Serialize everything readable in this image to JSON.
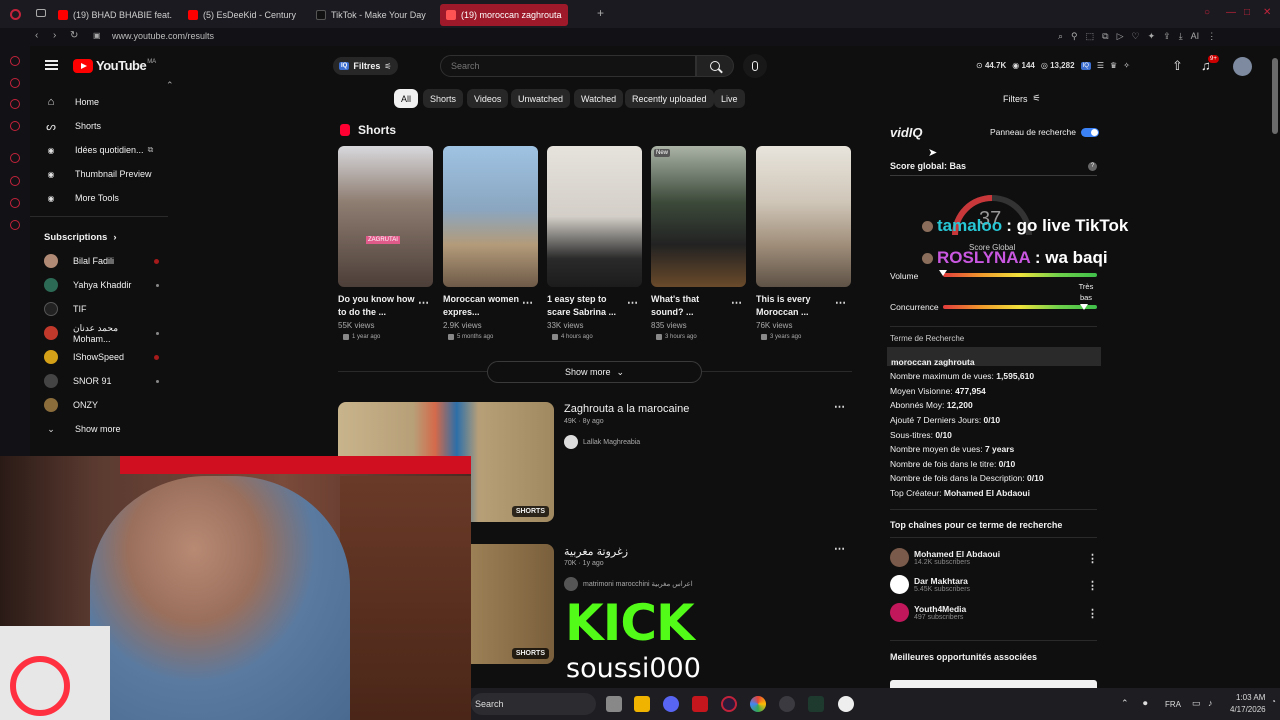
{
  "browser": {
    "tabs": [
      {
        "label": "(19) BHAD BHABIE feat. Li",
        "active": false
      },
      {
        "label": "(5) EsDeeKid - Century -",
        "active": false
      },
      {
        "label": "TikTok - Make Your Day",
        "active": false
      },
      {
        "label": "(19) moroccan zaghrouta",
        "active": true
      }
    ],
    "url": "www.youtube.com/results"
  },
  "header": {
    "logo": "YouTube",
    "country": "MA",
    "filters_label": "Filtres",
    "search_placeholder": "Search",
    "stats": [
      "44.7K",
      "144",
      "13,282"
    ],
    "notif_badge": "9+"
  },
  "sidebar": {
    "items": [
      {
        "label": "Home",
        "icon": "home-icon"
      },
      {
        "label": "Shorts",
        "icon": "shorts-icon"
      },
      {
        "label": "Idées quotidien...",
        "icon": "idea-icon"
      },
      {
        "label": "Thumbnail Preview",
        "icon": "preview-icon"
      },
      {
        "label": "More Tools",
        "icon": "tools-icon"
      }
    ],
    "subscriptions_title": "Subscriptions",
    "subscriptions": [
      {
        "name": "Bilal Fadili",
        "color": "#b08a74",
        "live": "#a51a1a"
      },
      {
        "name": "Yahya Khaddir",
        "color": "#2c6a55",
        "live": "#888888"
      },
      {
        "name": "TIF",
        "color": "#222222",
        "live": ""
      },
      {
        "name": "محمد عدنان Moham...",
        "color": "#c0392b",
        "live": "#888888"
      },
      {
        "name": "IShowSpeed",
        "color": "#d4a017",
        "live": "#a51a1a"
      },
      {
        "name": "SNOR 91",
        "color": "#444444",
        "live": "#888888"
      },
      {
        "name": "ONZY",
        "color": "#8a6d3b",
        "live": ""
      }
    ],
    "show_more": "Show more"
  },
  "chips": [
    "All",
    "Shorts",
    "Videos",
    "Unwatched",
    "Watched",
    "Recently uploaded",
    "Live"
  ],
  "filters_right": "Filters",
  "shorts": {
    "section_title": "Shorts",
    "items": [
      {
        "title": "Do you know how to do the ...",
        "views": "55K views",
        "ago": "1 year ago",
        "thumb": "#8a7a6f"
      },
      {
        "title": "Moroccan women expres...",
        "views": "2.9K views",
        "ago": "5 months ago",
        "thumb": "#6f8fa8"
      },
      {
        "title": "1 easy step to scare Sabrina ...",
        "views": "33K views",
        "ago": "4 hours ago",
        "thumb": "#c9c4bd"
      },
      {
        "title": "What's that sound? ...",
        "views": "835 views",
        "ago": "3 hours ago",
        "thumb": "#4d5a4c"
      },
      {
        "title": "This is every Moroccan ...",
        "views": "76K views",
        "ago": "3 years ago",
        "thumb": "#8a7f72"
      }
    ],
    "show_more": "Show more"
  },
  "videos": [
    {
      "title": "Zaghrouta a la marocaine",
      "meta": "49K · 8y ago",
      "channel": "Lallak Maghreabia",
      "badge": "SHORTS"
    },
    {
      "title": "زغروتة مغربية",
      "meta": "70K · 1y ago",
      "channel": "matrimoni marocchini اعراس مغربية",
      "badge": "SHORTS"
    }
  ],
  "overlay": {
    "kick": "KICK",
    "handle": "soussi000",
    "chat1_user": "tamaloo",
    "chat1_msg": " : go live TikTok",
    "chat2_user": "ROSLYNAA",
    "chat2_msg": " : wa baqi"
  },
  "vidiq": {
    "logo": "vidIQ",
    "panel_label": "Panneau de recherche",
    "score_title": "Score global: Bas",
    "score_value": "37",
    "score_caption": "Score Global",
    "volume_label": "Volume",
    "volume_level_label": "Très bas",
    "concurrence_label": "Concurrence",
    "term_label": "Terme de Recherche",
    "term_value": "moroccan zaghrouta",
    "stats": [
      {
        "label": "Nombre maximum de vues: ",
        "value": "1,595,610"
      },
      {
        "label": "Moyen Visionne: ",
        "value": "477,954"
      },
      {
        "label": "Abonnés Moy: ",
        "value": "12,200"
      },
      {
        "label": "Ajouté 7 Derniers Jours: ",
        "value": "0/10"
      },
      {
        "label": "Sous-titres: ",
        "value": "0/10"
      },
      {
        "label": "Nombre moyen de vues: ",
        "value": "7 years"
      },
      {
        "label": "Nombre de fois dans le titre: ",
        "value": "0/10"
      },
      {
        "label": "Nombre de fois dans la Description: ",
        "value": "0/10"
      },
      {
        "label": "Top Créateur: ",
        "value": "Mohamed El Abdaoui"
      }
    ],
    "top_channels_title": "Top chaînes pour ce terme de recherche",
    "top_channels": [
      {
        "name": "Mohamed El Abdaoui",
        "subs": "14.2K subscribers",
        "color": "#7a5a4a"
      },
      {
        "name": "Dar Makhtara",
        "subs": "5.45K subscribers",
        "color": "#ffffff"
      },
      {
        "name": "Youth4Media",
        "subs": "497 subscribers",
        "color": "#c2185b"
      }
    ],
    "opportunities_title": "Meilleures opportunités associées"
  },
  "taskbar": {
    "search": "Search",
    "lang": "FRA",
    "time": "1:03 AM",
    "date": "4/17/2026"
  }
}
